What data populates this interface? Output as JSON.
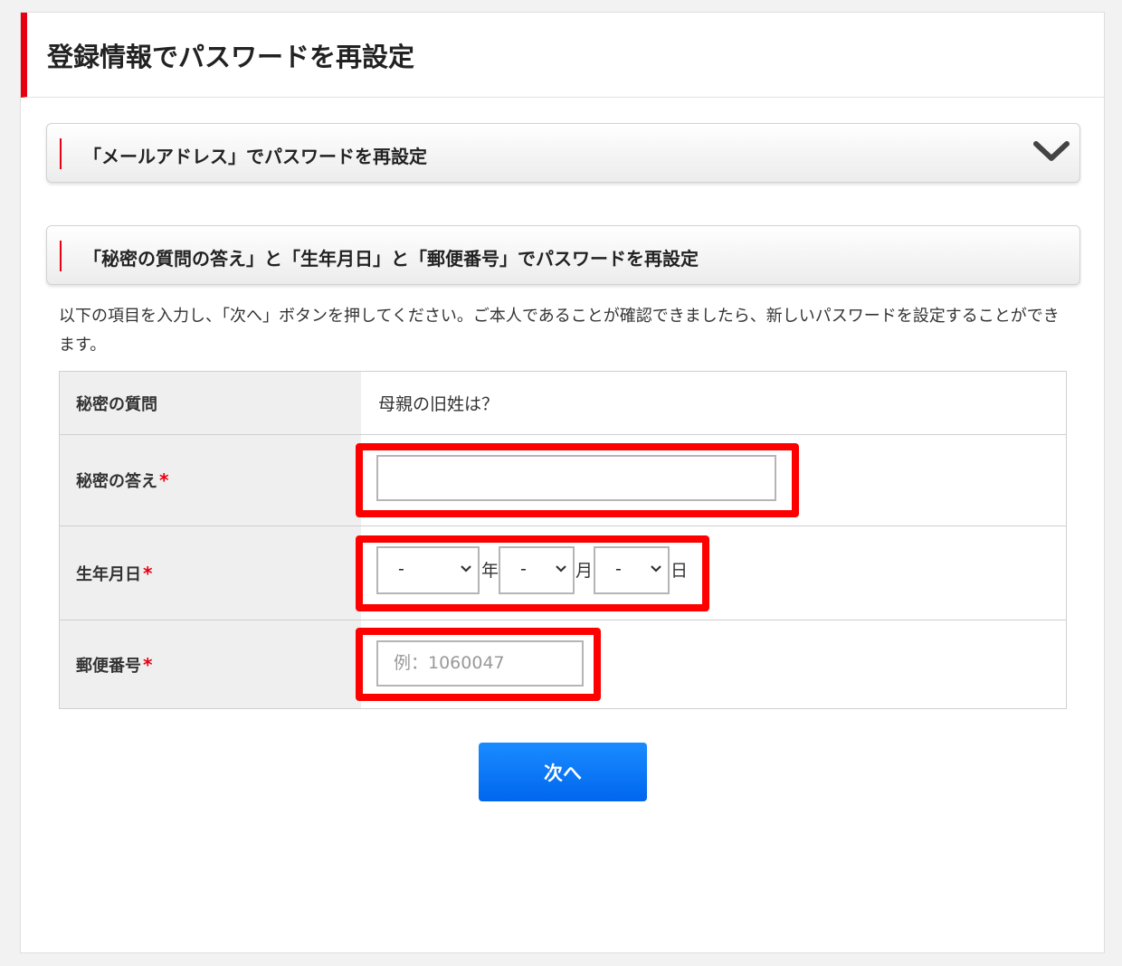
{
  "page": {
    "title": "登録情報でパスワードを再設定"
  },
  "accordion_email": {
    "title": "「メールアドレス」でパスワードを再設定",
    "icon": "chevron-down-icon"
  },
  "accordion_secret": {
    "title": "「秘密の質問の答え」と「生年月日」と「郵便番号」でパスワードを再設定"
  },
  "intro_text": "以下の項目を入力し、「次へ」ボタンを押してください。ご本人であることが確認できましたら、新しいパスワードを設定することができます。",
  "form": {
    "question_label": "秘密の質問",
    "question_value": "母親の旧姓は？",
    "answer_label": "秘密の答え",
    "answer_value": "",
    "birthday_label": "生年月日",
    "year_value": "-",
    "year_unit": "年",
    "month_value": "-",
    "month_unit": "月",
    "day_value": "-",
    "day_unit": "日",
    "zip_label": "郵便番号",
    "zip_placeholder": "例：1060047",
    "required_mark": "*"
  },
  "next_button": {
    "label": "次へ"
  },
  "colors": {
    "accent_red": "#e60012",
    "highlight_red": "#ff0000",
    "button_blue": "#0a7bff"
  }
}
